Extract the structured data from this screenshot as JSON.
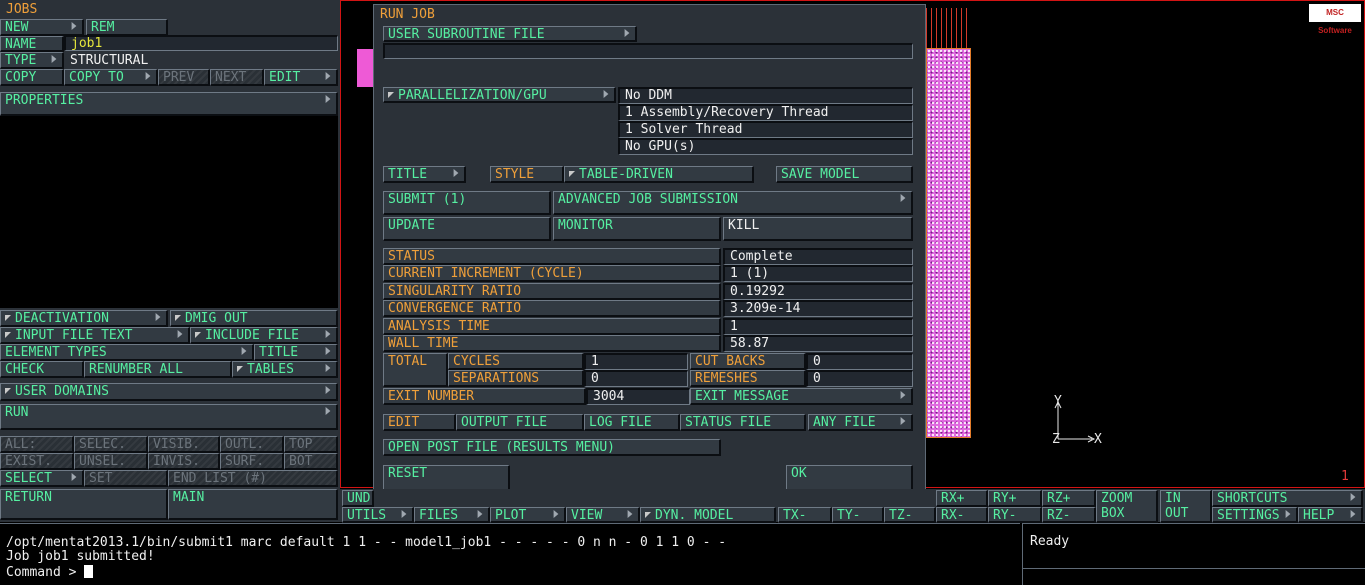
{
  "jobs_panel": {
    "title": "JOBS",
    "new": "NEW",
    "rem": "REM",
    "name_label": "NAME",
    "name_value": "job1",
    "type_label": "TYPE",
    "type_value": "STRUCTURAL",
    "copy": "COPY",
    "copy_to": "COPY TO",
    "prev": "PREV",
    "next": "NEXT",
    "edit": "EDIT",
    "properties": "PROPERTIES",
    "deactivation": "DEACTIVATION",
    "dmig_out": "DMIG OUT",
    "input_file_text": "INPUT FILE TEXT",
    "include_file": "INCLUDE FILE",
    "element_types": "ELEMENT TYPES",
    "title_btn": "TITLE",
    "check": "CHECK",
    "renumber_all": "RENUMBER ALL",
    "tables": "TABLES",
    "user_domains": "USER DOMAINS",
    "run": "RUN",
    "all": "ALL:",
    "selec": "SELEC.",
    "visib": "VISIB.",
    "outl": "OUTL.",
    "top": "TOP",
    "exist": "EXIST.",
    "unsel": "UNSEL.",
    "invis": "INVIS.",
    "surf": "SURF.",
    "bot": "BOT",
    "select": "SELECT",
    "set": "SET",
    "end_list": "END LIST (#)",
    "return": "RETURN",
    "main": "MAIN"
  },
  "run_job": {
    "title": "RUN JOB",
    "user_subroutine_file": "USER SUBROUTINE FILE",
    "subroutine_value": "",
    "parallelization": "PARALLELIZATION/GPU",
    "parallel_info": [
      "No DDM",
      "1 Assembly/Recovery Thread",
      "1 Solver Thread",
      "No GPU(s)"
    ],
    "title_btn": "TITLE",
    "style_label": "STYLE",
    "style_value": "TABLE-DRIVEN",
    "save_model": "SAVE MODEL",
    "submit": "SUBMIT (1)",
    "advanced": "ADVANCED JOB SUBMISSION",
    "update": "UPDATE",
    "monitor": "MONITOR",
    "kill": "KILL",
    "status_rows": [
      {
        "label": "STATUS",
        "value": "Complete"
      },
      {
        "label": "CURRENT INCREMENT (CYCLE)",
        "value": "1 (1)"
      },
      {
        "label": "SINGULARITY RATIO",
        "value": "0.19292"
      },
      {
        "label": "CONVERGENCE RATIO",
        "value": "3.209e-14"
      },
      {
        "label": "ANALYSIS TIME",
        "value": "1"
      },
      {
        "label": "WALL TIME",
        "value": "58.87"
      }
    ],
    "total": "TOTAL",
    "cycles_label": "CYCLES",
    "cycles_value": "1",
    "cut_backs_label": "CUT BACKS",
    "cut_backs_value": "0",
    "separations_label": "SEPARATIONS",
    "separations_value": "0",
    "remeshes_label": "REMESHES",
    "remeshes_value": "0",
    "exit_number_label": "EXIT NUMBER",
    "exit_number_value": "3004",
    "exit_message": "EXIT MESSAGE",
    "edit_label": "EDIT",
    "output_file": "OUTPUT FILE",
    "log_file": "LOG FILE",
    "status_file": "STATUS FILE",
    "any_file": "ANY FILE",
    "open_post": "OPEN POST FILE (RESULTS MENU)",
    "reset": "RESET",
    "ok": "OK"
  },
  "viewport": {
    "logo": "MSC Software",
    "axis_y": "Y",
    "axis_z": "Z",
    "axis_x": "X",
    "number": "1"
  },
  "toolbar": {
    "und": "UND",
    "utils": "UTILS",
    "files": "FILES",
    "plot": "PLOT",
    "view": "VIEW",
    "dyn_model": "DYN. MODEL",
    "tx": "TX-",
    "ty": "TY-",
    "tz": "TZ-",
    "rx_plus": "RX+",
    "rx_minus": "RX-",
    "ry_plus": "RY+",
    "ry_minus": "RY-",
    "rz_plus": "RZ+",
    "rz_minus": "RZ-",
    "zoom": "ZOOM",
    "box": "BOX",
    "in": "IN",
    "out": "OUT",
    "shortcuts": "SHORTCUTS",
    "settings": "SETTINGS",
    "help": "HELP"
  },
  "console": {
    "line1": "/opt/mentat2013.1/bin/submit1 marc default 1 1 - - model1_job1 - - - - - 0 n n - 0 1 1 0 - -",
    "line2": "Job job1 submitted!",
    "prompt": "Command > "
  },
  "status_box": {
    "text": "Ready"
  }
}
